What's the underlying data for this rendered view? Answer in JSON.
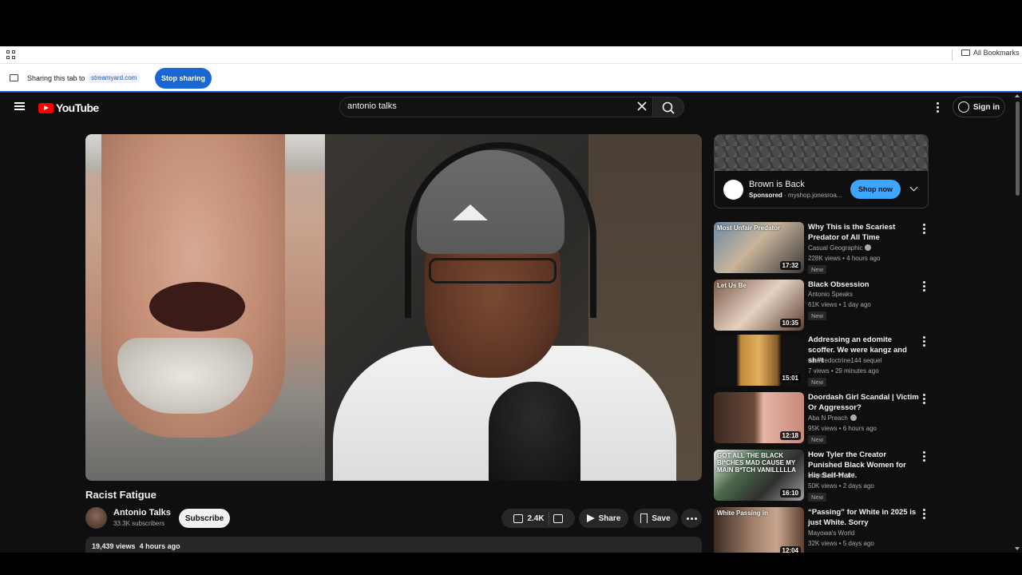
{
  "browser": {
    "bookmarks_label": "All Bookmarks",
    "share_text": "Sharing this tab to",
    "share_target": "streamyard.com",
    "stop_button": "Stop sharing"
  },
  "header": {
    "logo": "YouTube",
    "search_value": "antonio talks",
    "sign_in": "Sign in"
  },
  "video": {
    "title": "Racist Fatigue",
    "channel": "Antonio Talks",
    "subscribers": "33.3K subscribers",
    "subscribe_label": "Subscribe",
    "likes": "2.4K",
    "share_label": "Share",
    "save_label": "Save",
    "views": "19,439 views",
    "posted": "4 hours ago"
  },
  "ad": {
    "title": "Brown is Back",
    "sponsored": "Sponsored",
    "domain": "· myshop.jonesroa...",
    "cta": "Shop now"
  },
  "recommendations": [
    {
      "title": "Why This is the Scariest Predator of All Time",
      "channel": "Casual Geographic",
      "verified": true,
      "views": "228K views",
      "age": "4 hours ago",
      "badge": "New",
      "duration": "17:32",
      "thumb_text": "Most Unfair Predator"
    },
    {
      "title": "Black Obsession",
      "channel": "Antonio Speaks",
      "verified": false,
      "views": "61K views",
      "age": "1 day ago",
      "badge": "New",
      "duration": "10:35",
      "thumb_text": "Let Us Be"
    },
    {
      "title": "Addressing an edomite scoffer. We were kangz and sh#t",
      "channel": "thetruedoctrine144 sequel",
      "verified": false,
      "views": "7 views",
      "age": "29 minutes ago",
      "badge": "New",
      "duration": "15:01",
      "thumb_text": ""
    },
    {
      "title": "Doordash Girl Scandal | Victim Or Aggressor?",
      "channel": "Aba N Preach",
      "verified": true,
      "views": "95K views",
      "age": "6 hours ago",
      "badge": "New",
      "duration": "12:18",
      "thumb_text": ""
    },
    {
      "title": "How Tyler the Creator Punished Black Women for His Self-Hate.",
      "channel": "Mayowa's World",
      "verified": false,
      "views": "50K views",
      "age": "2 days ago",
      "badge": "New",
      "duration": "16:10",
      "thumb_text": "GOT ALL THE BLACK BI*CHES MAD CAUSE MY MAIN B*TCH VANILLLLLA"
    },
    {
      "title": "“Passing” for White in 2025 is just White. Sorry",
      "channel": "Mayowa's World",
      "verified": false,
      "views": "32K views",
      "age": "5 days ago",
      "badge": "",
      "duration": "12:04",
      "thumb_text": "White Passing in"
    }
  ]
}
